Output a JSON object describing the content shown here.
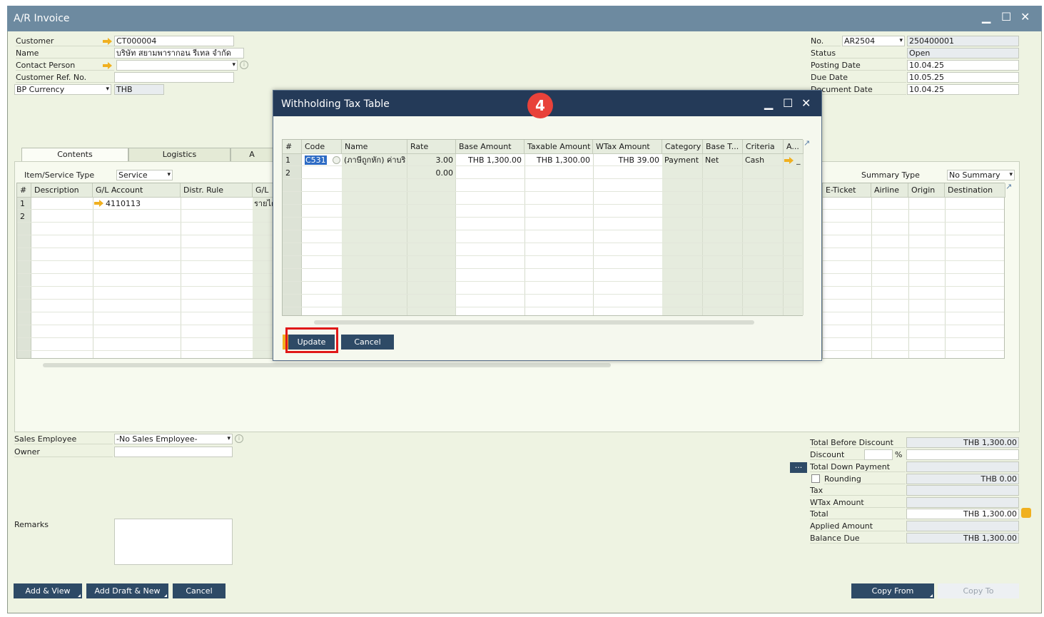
{
  "window": {
    "title": "A/R Invoice"
  },
  "header_left": {
    "customer_label": "Customer",
    "customer_value": "CT000004",
    "name_label": "Name",
    "name_value": "บริษัท สยามพารากอน รีเทล จำกัด",
    "contact_label": "Contact Person",
    "contact_value": "",
    "custref_label": "Customer Ref. No.",
    "custref_value": "",
    "currency_label": "BP Currency",
    "currency_value": "THB"
  },
  "header_right": {
    "no_label": "No.",
    "series_value": "AR2504",
    "no_value": "250400001",
    "status_label": "Status",
    "status_value": "Open",
    "posting_label": "Posting Date",
    "posting_value": "10.04.25",
    "due_label": "Due Date",
    "due_value": "10.05.25",
    "docdate_label": "Document Date",
    "docdate_value": "10.04.25"
  },
  "tabs": {
    "contents": "Contents",
    "logistics": "Logistics",
    "a": "A"
  },
  "contents": {
    "item_type_label": "Item/Service Type",
    "item_type_value": "Service",
    "summary_type_label": "Summary Type",
    "summary_type_value": "No Summary",
    "columns": [
      "#",
      "Description",
      "G/L Account",
      "Distr. Rule",
      "G/L"
    ],
    "right_columns": [
      "E-Ticket",
      "Airline",
      "Origin",
      "Destination"
    ],
    "rows": [
      {
        "num": "1",
        "gl_account": "4110113",
        "gl_name": "รายได"
      },
      {
        "num": "2",
        "gl_account": "",
        "gl_name": ""
      }
    ]
  },
  "footer_left": {
    "sales_emp_label": "Sales Employee",
    "sales_emp_value": "-No Sales Employee-",
    "owner_label": "Owner",
    "owner_value": "",
    "remarks_label": "Remarks"
  },
  "totals": {
    "tbd_label": "Total Before Discount",
    "tbd_value": "THB 1,300.00",
    "discount_label": "Discount",
    "discount_pct": "%",
    "tdp_label": "Total Down Payment",
    "rounding_label": "Rounding",
    "rounding_value": "THB 0.00",
    "tax_label": "Tax",
    "wtax_label": "WTax Amount",
    "total_label": "Total",
    "total_value": "THB 1,300.00",
    "applied_label": "Applied Amount",
    "balance_label": "Balance Due",
    "balance_value": "THB 1,300.00",
    "more_btn": "..."
  },
  "buttons": {
    "add_view": "Add & View",
    "add_draft": "Add Draft & New",
    "cancel": "Cancel",
    "copy_from": "Copy From",
    "copy_to": "Copy To"
  },
  "dialog": {
    "title": "Withholding Tax Table",
    "step_badge": "4",
    "columns": [
      "#",
      "Code",
      "Name",
      "Rate",
      "Base Amount",
      "Taxable Amount",
      "WTax Amount",
      "Category",
      "Base T...",
      "Criteria",
      "A..."
    ],
    "rows": [
      {
        "num": "1",
        "code": "C531",
        "name": "(ภาษีถูกหัก) ค่าบริ",
        "rate": "3.00",
        "base": "THB 1,300.00",
        "taxable": "THB 1,300.00",
        "wtax": "THB 39.00",
        "category": "Payment",
        "base_type": "Net",
        "criteria": "Cash",
        "extra": "_"
      },
      {
        "num": "2",
        "code": "",
        "name": "",
        "rate": "0.00",
        "base": "",
        "taxable": "",
        "wtax": "",
        "category": "",
        "base_type": "",
        "criteria": "",
        "extra": ""
      }
    ],
    "update_btn": "Update",
    "cancel_btn": "Cancel"
  }
}
